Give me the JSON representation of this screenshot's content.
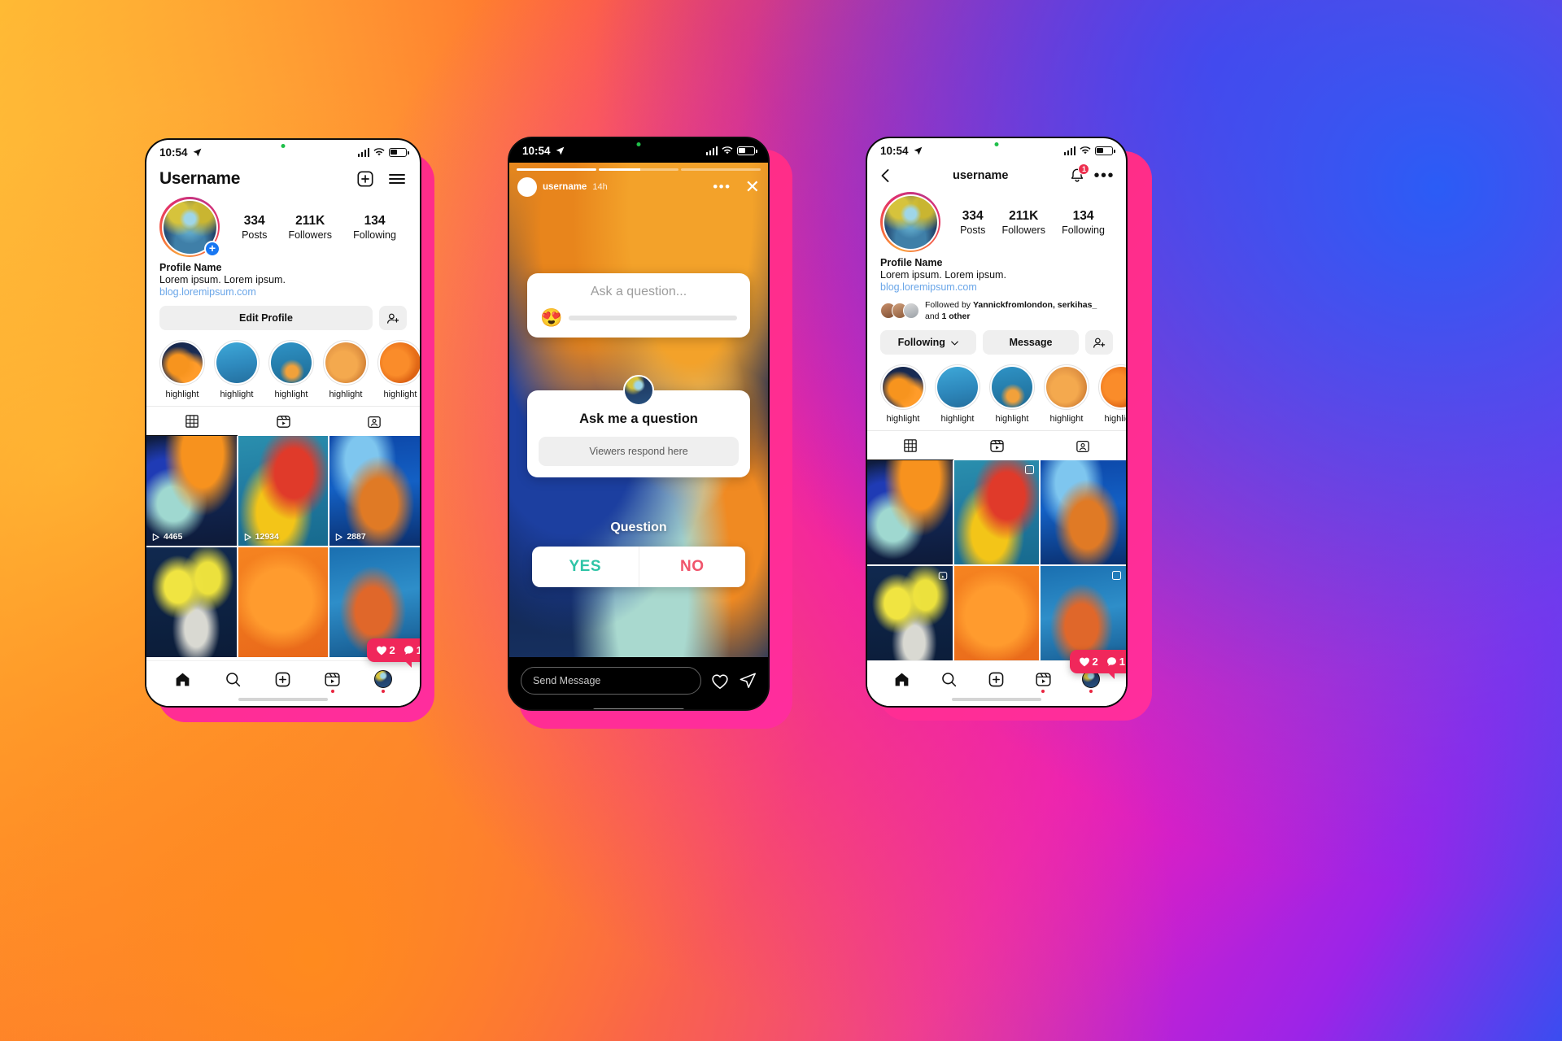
{
  "background": {
    "colors": [
      "#ffb02e",
      "#ff6a2b",
      "#f8326d",
      "#e81ec0",
      "#9b24e8",
      "#3a4df0"
    ]
  },
  "status_bar": {
    "time": "10:54",
    "location_icon": "location-arrow-icon",
    "signal_icon": "cellular-signal-icon",
    "wifi_icon": "wifi-icon",
    "battery_icon": "battery-icon"
  },
  "phone1": {
    "header": {
      "title": "Username",
      "add_icon": "add-post-icon",
      "menu_icon": "hamburger-menu-icon"
    },
    "profile": {
      "avatar": "profile-avatar",
      "add_story_badge": "+",
      "name": "Profile Name",
      "bio": "Lorem ipsum. Lorem ipsum.",
      "link": "blog.loremipsum.com",
      "link_color": "#6aa6e8"
    },
    "stats": [
      {
        "num": "334",
        "label": "Posts"
      },
      {
        "num": "211K",
        "label": "Followers"
      },
      {
        "num": "134",
        "label": "Following"
      }
    ],
    "actions": {
      "edit_profile": "Edit Profile",
      "add_person_icon": "add-person-icon"
    },
    "highlights": [
      {
        "label": "highlight"
      },
      {
        "label": "highlight"
      },
      {
        "label": "highlight"
      },
      {
        "label": "highlight"
      },
      {
        "label": "highlight"
      }
    ],
    "tabs": [
      {
        "icon": "grid-icon",
        "active": true
      },
      {
        "icon": "reels-icon",
        "active": false
      },
      {
        "icon": "tagged-icon",
        "active": false
      }
    ],
    "grid": [
      {
        "plays": "4465",
        "type": "reel"
      },
      {
        "plays": "12934",
        "type": "reel"
      },
      {
        "plays": "2887",
        "type": "reel"
      },
      {
        "plays": "",
        "type": "photo"
      },
      {
        "plays": "",
        "type": "photo"
      },
      {
        "plays": "",
        "type": "photo"
      }
    ],
    "engagement_badge": {
      "likes": "2",
      "comments": "1",
      "heart_icon": "heart-icon",
      "comment_icon": "comment-icon",
      "color": "#f0275b"
    },
    "bottom_nav": [
      {
        "icon": "home-icon",
        "active": true
      },
      {
        "icon": "search-icon",
        "active": false
      },
      {
        "icon": "create-icon",
        "active": false
      },
      {
        "icon": "reels-icon",
        "active": false,
        "dot": true
      },
      {
        "icon": "profile-avatar-icon",
        "active": false,
        "dot": true
      }
    ]
  },
  "phone2": {
    "story_header": {
      "username": "username",
      "time": "14h",
      "more_icon": "more-options-icon",
      "close_icon": "close-icon"
    },
    "progress": [
      "done",
      "part",
      "empty"
    ],
    "question_slider_card": {
      "placeholder": "Ask a question...",
      "emoji": "😍",
      "slider_value": 0
    },
    "question_card": {
      "title": "Ask me a question",
      "respond_placeholder": "Viewers respond here",
      "avatar": "story-author-avatar"
    },
    "poll": {
      "question": "Question",
      "options": [
        {
          "label": "YES",
          "color": "#2ec4a6"
        },
        {
          "label": "NO",
          "color": "#f0556c"
        }
      ]
    },
    "footer": {
      "message_placeholder": "Send Message",
      "heart_icon": "heart-icon",
      "share_icon": "share-icon"
    }
  },
  "phone3": {
    "header": {
      "back_icon": "back-chevron-icon",
      "title": "username",
      "bell_icon": "notifications-bell-icon",
      "bell_badge": "1",
      "more_icon": "more-options-icon"
    },
    "profile": {
      "name": "Profile Name",
      "bio": "Lorem ipsum. Lorem ipsum.",
      "link": "blog.loremipsum.com"
    },
    "stats": [
      {
        "num": "334",
        "label": "Posts"
      },
      {
        "num": "211K",
        "label": "Followers"
      },
      {
        "num": "134",
        "label": "Following"
      }
    ],
    "followed_by": {
      "prefix": "Followed by ",
      "names": "Yannickfromlondon, serkihas_",
      "suffix_pre": " and ",
      "count": "1 other"
    },
    "actions": {
      "following": "Following",
      "following_chevron": "chevron-down-icon",
      "message": "Message",
      "add_person_icon": "add-person-icon"
    },
    "highlights": [
      {
        "label": "highlight"
      },
      {
        "label": "highlight"
      },
      {
        "label": "highlight"
      },
      {
        "label": "highlight"
      },
      {
        "label": "highlight"
      }
    ],
    "tabs": [
      {
        "icon": "grid-icon",
        "active": true
      },
      {
        "icon": "reels-icon",
        "active": false
      },
      {
        "icon": "tagged-icon",
        "active": false
      }
    ],
    "engagement_badge": {
      "likes": "2",
      "comments": "1"
    },
    "bottom_nav": [
      {
        "icon": "home-icon",
        "active": true
      },
      {
        "icon": "search-icon",
        "active": false
      },
      {
        "icon": "create-icon",
        "active": false
      },
      {
        "icon": "reels-icon",
        "active": false,
        "dot": true
      },
      {
        "icon": "profile-avatar-icon",
        "active": false,
        "dot": true
      }
    ]
  }
}
